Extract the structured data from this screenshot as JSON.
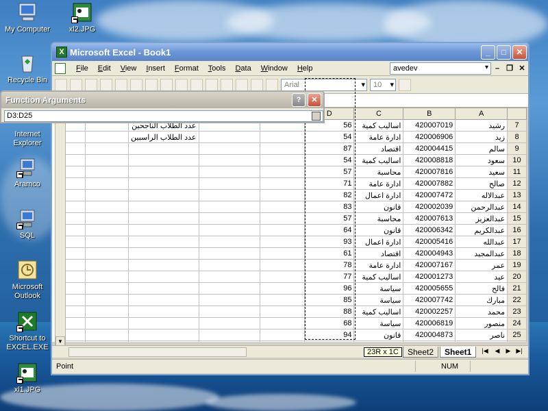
{
  "desktop": {
    "icons": [
      {
        "label": "My Computer"
      },
      {
        "label": "xl2.JPG"
      },
      {
        "label": "Recycle Bin"
      },
      {
        "label": "Internet Explorer"
      },
      {
        "label": "Aramco"
      },
      {
        "label": "SQL"
      },
      {
        "label": "Microsoft Outlook"
      },
      {
        "label": "Shortcut to EXCEL.EXE"
      },
      {
        "label": "xl1.JPG"
      }
    ]
  },
  "window": {
    "title": "Microsoft Excel - Book1",
    "menu": [
      "File",
      "Edit",
      "View",
      "Insert",
      "Format",
      "Tools",
      "Data",
      "Window",
      "Help"
    ],
    "help_box_value": "avedev",
    "font_name": "Arial",
    "font_size": "10"
  },
  "dialog": {
    "title": "Function Arguments",
    "range_value": "D3:D25"
  },
  "grid": {
    "column_headers": [
      "",
      "",
      "",
      "",
      "",
      "D",
      "C",
      "B",
      "A",
      ""
    ],
    "notes": [
      "عدد الطلاب الناجحين",
      "عدد الطلاب الراسبين"
    ],
    "rows": [
      {
        "row": "7",
        "name": "رشيد",
        "id": "420007019",
        "dept": "اساليب كمية",
        "score": "56"
      },
      {
        "row": "8",
        "name": "زيد",
        "id": "420006906",
        "dept": "ادارة عامة",
        "score": "54"
      },
      {
        "row": "9",
        "name": "سالم",
        "id": "420004415",
        "dept": "اقتصاد",
        "score": "87"
      },
      {
        "row": "10",
        "name": "سعود",
        "id": "420008818",
        "dept": "اساليب كمية",
        "score": "54"
      },
      {
        "row": "11",
        "name": "سعيد",
        "id": "420007816",
        "dept": "محاسبة",
        "score": "57"
      },
      {
        "row": "12",
        "name": "صالح",
        "id": "420007882",
        "dept": "ادارة عامة",
        "score": "71"
      },
      {
        "row": "13",
        "name": "عبدالاله",
        "id": "420007472",
        "dept": "ادارة اعمال",
        "score": "82"
      },
      {
        "row": "14",
        "name": "عبدالرحمن",
        "id": "420002039",
        "dept": "قانون",
        "score": "83"
      },
      {
        "row": "15",
        "name": "عبدالعزيز",
        "id": "420007613",
        "dept": "محاسبة",
        "score": "57"
      },
      {
        "row": "16",
        "name": "عبدالكريم",
        "id": "420006342",
        "dept": "قانون",
        "score": "64"
      },
      {
        "row": "17",
        "name": "عبدالله",
        "id": "420005416",
        "dept": "ادارة اعمال",
        "score": "93"
      },
      {
        "row": "18",
        "name": "عبدالمجيد",
        "id": "420004943",
        "dept": "اقتصاد",
        "score": "61"
      },
      {
        "row": "19",
        "name": "عمر",
        "id": "420007167",
        "dept": "ادارة عامة",
        "score": "78"
      },
      {
        "row": "20",
        "name": "عيد",
        "id": "420001273",
        "dept": "اساليب كمية",
        "score": "77"
      },
      {
        "row": "21",
        "name": "فالح",
        "id": "420005655",
        "dept": "سياسة",
        "score": "96"
      },
      {
        "row": "22",
        "name": "مبارك",
        "id": "420007742",
        "dept": "سياسة",
        "score": "85"
      },
      {
        "row": "23",
        "name": "محمد",
        "id": "420002257",
        "dept": "اساليب كمية",
        "score": "88"
      },
      {
        "row": "24",
        "name": "منصور",
        "id": "420006819",
        "dept": "سياسة",
        "score": "68"
      },
      {
        "row": "25",
        "name": "ناصر",
        "id": "420004873",
        "dept": "قانون",
        "score": "94"
      },
      {
        "row": "26",
        "name": "",
        "id": "",
        "dept": "",
        "score": ""
      }
    ]
  },
  "tabs": {
    "sheets": [
      "Sheet2",
      "Sheet1"
    ],
    "selection_tip": "23R x 1C"
  },
  "status": {
    "mode": "Point",
    "num": "NUM"
  }
}
